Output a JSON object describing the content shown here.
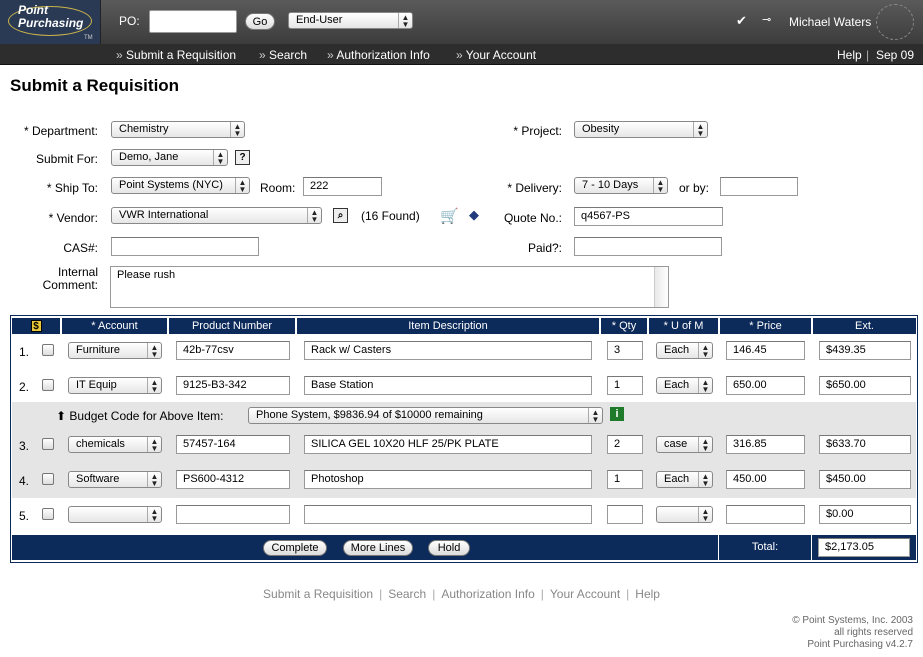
{
  "topbar": {
    "logo_line1": "Point",
    "logo_line2": "Purchasing",
    "logo_tm": "TM",
    "po_label": "PO:",
    "po_value": "",
    "go_label": "Go",
    "role_value": "End-User",
    "check_icon": "✔",
    "key_icon": "⊸",
    "user_name": "Michael Waters"
  },
  "nav": {
    "items": [
      "Submit a Requisition",
      "Search",
      "Authorization Info",
      "Your Account"
    ],
    "help": "Help",
    "sep": "|",
    "date": "Sep 09"
  },
  "page_title": "Submit a Requisition",
  "form": {
    "department_label": "* Department:",
    "department_value": "Chemistry",
    "project_label": "* Project:",
    "project_value": "Obesity",
    "submit_for_label": "Submit For:",
    "submit_for_value": "Demo, Jane",
    "help_icon": "?",
    "ship_to_label": "* Ship To:",
    "ship_to_value": "Point Systems (NYC)",
    "room_label": "Room:",
    "room_value": "222",
    "delivery_label": "* Delivery:",
    "delivery_value": "7 - 10 Days",
    "or_by_label": "or by:",
    "or_by_value": "",
    "vendor_label": "* Vendor:",
    "vendor_value": "VWR International",
    "found_text": "(16 Found)",
    "quote_label": "Quote No.:",
    "quote_value": "q4567-PS",
    "cas_label": "CAS#:",
    "cas_value": "",
    "paid_label": "Paid?:",
    "paid_value": "",
    "comment_label_1": "Internal",
    "comment_label_2": "Comment:",
    "comment_value": "Please rush"
  },
  "table": {
    "headers": [
      "$",
      "* Account",
      "Product Number",
      "Item Description",
      "* Qty",
      "* U of M",
      "* Price",
      "Ext."
    ],
    "rows": [
      {
        "num": "1.",
        "account": "Furniture",
        "product": "42b-77csv",
        "desc": "Rack w/ Casters",
        "qty": "3",
        "uom": "Each",
        "price": "146.45",
        "ext": "$439.35"
      },
      {
        "num": "2.",
        "account": "IT Equip",
        "product": "9125-B3-342",
        "desc": "Base Station",
        "qty": "1",
        "uom": "Each",
        "price": "650.00",
        "ext": "$650.00"
      },
      {
        "num": "3.",
        "account": "chemicals",
        "product": "57457-164",
        "desc": "SILICA GEL 10X20 HLF 25/PK PLATE",
        "qty": "2",
        "uom": "case",
        "price": "316.85",
        "ext": "$633.70"
      },
      {
        "num": "4.",
        "account": "Software",
        "product": "PS600-4312",
        "desc": "Photoshop",
        "qty": "1",
        "uom": "Each",
        "price": "450.00",
        "ext": "$450.00"
      },
      {
        "num": "5.",
        "account": "",
        "product": "",
        "desc": "",
        "qty": "",
        "uom": "",
        "price": "",
        "ext": "$0.00"
      }
    ],
    "budget_label": "Budget Code for Above Item:",
    "budget_value": "Phone System, $9836.94 of $10000 remaining",
    "budget_arrow": "⬆",
    "info_icon": "i",
    "buttons": {
      "complete": "Complete",
      "more_lines": "More Lines",
      "hold": "Hold"
    },
    "total_label": "Total:",
    "total_value": "$2,173.05"
  },
  "footer": {
    "links": [
      "Submit a Requisition",
      "Search",
      "Authorization Info",
      "Your Account",
      "Help"
    ],
    "sep": "|",
    "copyright_1": "© Point Systems, Inc. 2003",
    "copyright_2": "all rights reserved",
    "copyright_3": "Point Purchasing v4.2.7"
  },
  "colors": {
    "header_blue": "#0c2a5a",
    "topbar": "#4a4a4a",
    "navbar": "#2d2d2d",
    "alt_row": "#e5e5e5",
    "info_green": "#1f7a2a"
  }
}
